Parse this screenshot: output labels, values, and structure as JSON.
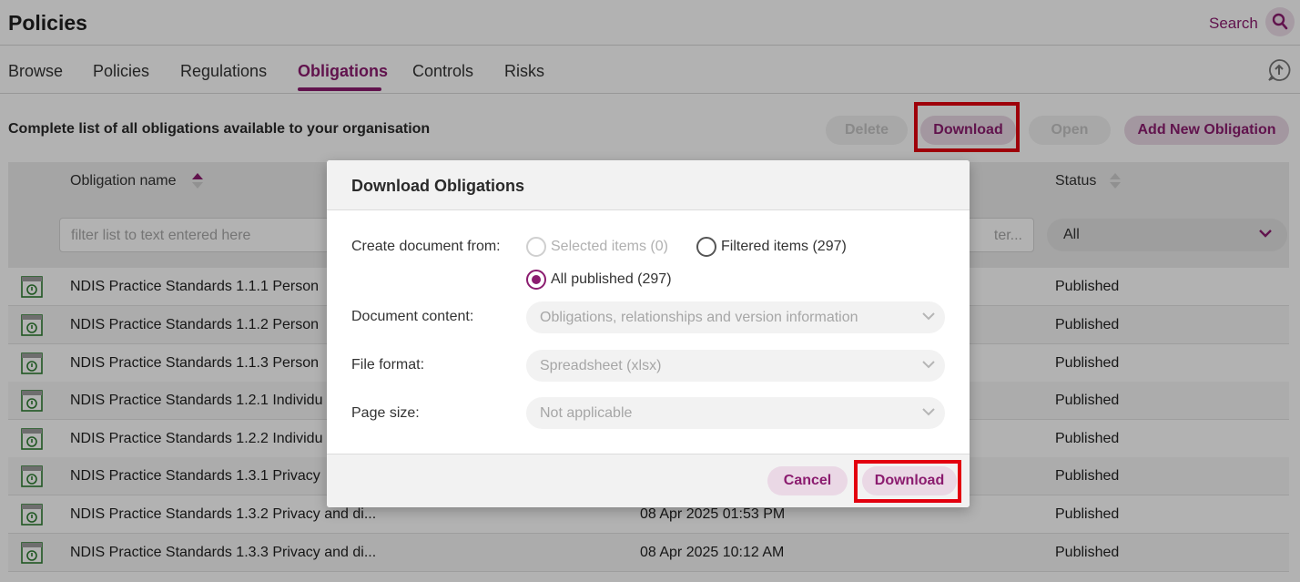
{
  "header": {
    "title": "Policies",
    "search_label": "Search"
  },
  "tabs": [
    {
      "label": "Browse",
      "active": false
    },
    {
      "label": "Policies",
      "active": false
    },
    {
      "label": "Regulations",
      "active": false
    },
    {
      "label": "Obligations",
      "active": true
    },
    {
      "label": "Controls",
      "active": false
    },
    {
      "label": "Risks",
      "active": false
    }
  ],
  "toolbar": {
    "subtitle": "Complete list of all obligations available to your organisation",
    "delete_label": "Delete",
    "download_label": "Download",
    "open_label": "Open",
    "add_label": "Add New Obligation"
  },
  "table": {
    "columns": {
      "name": "Obligation name",
      "status": "Status"
    },
    "name_filter_placeholder": "filter list to text entered here",
    "date_filter_fragment": "ter...",
    "status_filter_value": "All",
    "rows": [
      {
        "name": "NDIS Practice Standards 1.1.1 Person",
        "date": "",
        "status": "Published"
      },
      {
        "name": "NDIS Practice Standards 1.1.2 Person",
        "date": "",
        "status": "Published"
      },
      {
        "name": "NDIS Practice Standards 1.1.3 Person",
        "date": "",
        "status": "Published"
      },
      {
        "name": "NDIS Practice Standards 1.2.1 Individu",
        "date": "",
        "status": "Published"
      },
      {
        "name": "NDIS Practice Standards 1.2.2 Individu",
        "date": "",
        "status": "Published"
      },
      {
        "name": "NDIS Practice Standards 1.3.1 Privacy",
        "date": "",
        "status": "Published"
      },
      {
        "name": "NDIS Practice Standards 1.3.2 Privacy and di...",
        "date": "08 Apr 2025 01:53 PM",
        "status": "Published"
      },
      {
        "name": "NDIS Practice Standards 1.3.3 Privacy and di...",
        "date": "08 Apr 2025 10:12 AM",
        "status": "Published"
      }
    ]
  },
  "modal": {
    "title": "Download Obligations",
    "create_from_label": "Create document from:",
    "option_selected": "Selected items (0)",
    "option_filtered": "Filtered items (297)",
    "option_all": "All published (297)",
    "content_label": "Document content:",
    "content_value": "Obligations, relationships and version information",
    "format_label": "File format:",
    "format_value": "Spreadsheet (xlsx)",
    "page_size_label": "Page size:",
    "page_size_value": "Not applicable",
    "cancel_label": "Cancel",
    "download_label": "Download"
  },
  "colors": {
    "accent": "#8b1c6f",
    "highlight": "#e3000f"
  }
}
